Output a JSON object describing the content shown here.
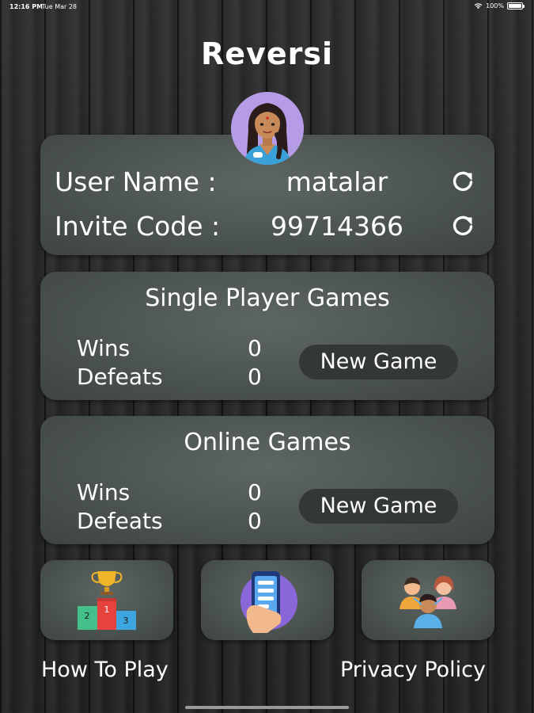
{
  "status_bar": {
    "time": "12:16 PM",
    "date": "Tue Mar 28",
    "battery": "100%"
  },
  "app": {
    "title": "Reversi"
  },
  "user_card": {
    "user_name_label": "User Name :",
    "user_name_value": "matalar",
    "invite_code_label": "Invite Code :",
    "invite_code_value": "99714366"
  },
  "single_player": {
    "title": "Single Player Games",
    "wins_label": "Wins",
    "wins_value": "0",
    "defeats_label": "Defeats",
    "defeats_value": "0",
    "new_game_label": "New Game"
  },
  "online": {
    "title": "Online Games",
    "wins_label": "Wins",
    "wins_value": "0",
    "defeats_label": "Defeats",
    "defeats_value": "0",
    "new_game_label": "New Game"
  },
  "bottom_tiles": {
    "how_to_play_label": "How To Play",
    "privacy_policy_label": "Privacy Policy",
    "icons": [
      "podium-trophy-icon",
      "phone-app-icon",
      "people-group-icon"
    ]
  },
  "colors": {
    "card": "#4c5452",
    "button": "#333735",
    "avatar_bg": "#b69be6"
  }
}
